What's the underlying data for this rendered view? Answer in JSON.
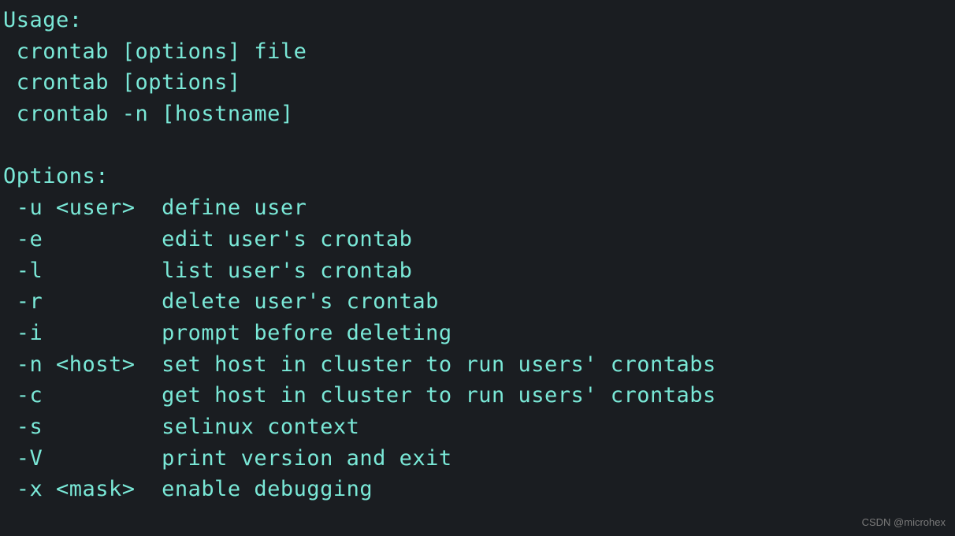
{
  "terminal": {
    "usage_header": "Usage:",
    "usage_line1": " crontab [options] file",
    "usage_line2": " crontab [options]",
    "usage_line3": " crontab -n [hostname]",
    "options_header": "Options:",
    "opt_u": " -u <user>  define user",
    "opt_e": " -e         edit user's crontab",
    "opt_l": " -l         list user's crontab",
    "opt_r": " -r         delete user's crontab",
    "opt_i": " -i         prompt before deleting",
    "opt_n": " -n <host>  set host in cluster to run users' crontabs",
    "opt_c": " -c         get host in cluster to run users' crontabs",
    "opt_s": " -s         selinux context",
    "opt_V": " -V         print version and exit",
    "opt_x": " -x <mask>  enable debugging"
  },
  "watermark": "CSDN @microhex"
}
